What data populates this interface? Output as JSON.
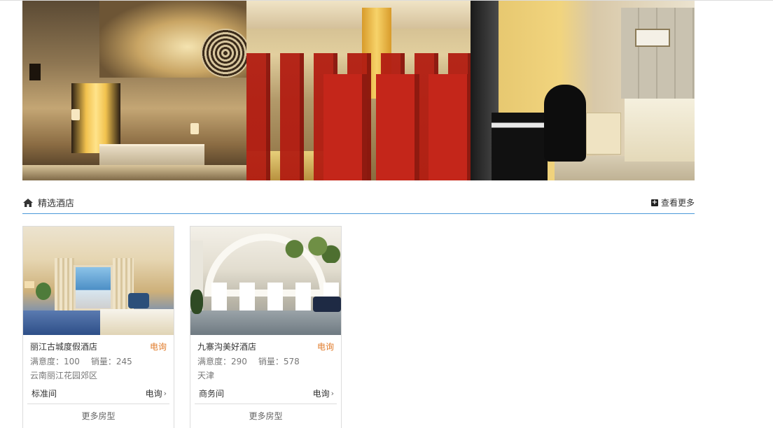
{
  "section": {
    "title": "精选酒店",
    "more_label": "查看更多"
  },
  "hotels": [
    {
      "name": "丽江古城度假酒店",
      "call_tag": "电询",
      "satisfaction": "满意度：100",
      "sales": "销量：245",
      "location": "云南丽江花园郊区",
      "room_type": "标准间",
      "room_price": "电询",
      "more_rooms": "更多房型"
    },
    {
      "name": "九寨沟美好酒店",
      "call_tag": "电询",
      "satisfaction": "满意度：290",
      "sales": "销量：578",
      "location": "天津",
      "room_type": "商务间",
      "room_price": "电询",
      "more_rooms": "更多房型"
    }
  ],
  "icons": {
    "section_icon": "home-icon",
    "more_icon": "plus-square-icon",
    "room_chevron": "chevron-right-icon"
  },
  "colors": {
    "accent_line": "#4a98d9",
    "call_tag": "#e07a28",
    "border": "#dcdcdc"
  }
}
